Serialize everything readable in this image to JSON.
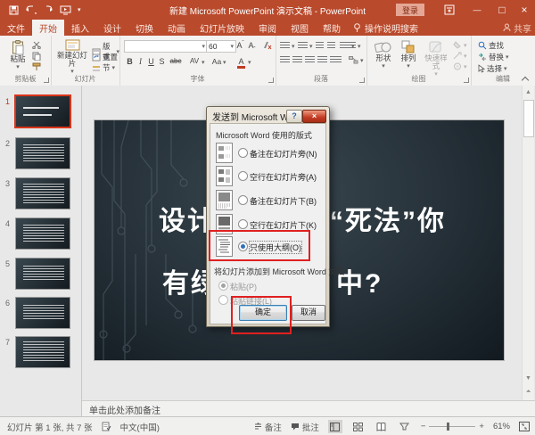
{
  "colors": {
    "accent_red": "#b94a2c",
    "selection_red": "#d8351a",
    "annotation_red": "#e02020",
    "signin_bg": "#e5a794",
    "slide_bg_center": "#3a4850",
    "slide_bg_edge": "#121a20"
  },
  "titlebar": {
    "title": "新建 Microsoft PowerPoint 演示文稿 - PowerPoint",
    "signin_label": "登录",
    "minimize_glyph": "—",
    "maximize_glyph": "□",
    "close_glyph": "×"
  },
  "tabs": [
    {
      "label": "文件"
    },
    {
      "label": "开始"
    },
    {
      "label": "插入"
    },
    {
      "label": "设计"
    },
    {
      "label": "切换"
    },
    {
      "label": "动画"
    },
    {
      "label": "幻灯片放映"
    },
    {
      "label": "审阅"
    },
    {
      "label": "视图"
    },
    {
      "label": "帮助"
    }
  ],
  "tellme_label": "操作说明搜索",
  "share_label": "共享",
  "ribbon": {
    "clipboard": {
      "group_label": "剪贴板",
      "paste_label": "粘贴"
    },
    "slides": {
      "group_label": "幻灯片",
      "new_slide_label": "新建幻灯片",
      "layout_label": "版式",
      "reset_label": "重置",
      "section_label": "节"
    },
    "font": {
      "group_label": "字体",
      "size_value": "60",
      "bold": "B",
      "italic": "I",
      "underline": "U",
      "strike": "S",
      "abc": "abc",
      "av": "AV",
      "aa": "Aa",
      "color": "A"
    },
    "paragraph": {
      "group_label": "段落"
    },
    "drawing": {
      "group_label": "绘图",
      "shapes_label": "形状",
      "arrange_label": "排列",
      "quick_styles_label": "快速样式"
    },
    "editing": {
      "group_label": "编辑",
      "find_label": "查找",
      "replace_label": "替换",
      "select_label": "选择"
    }
  },
  "slides_panel": {
    "selected_number": "1",
    "slides": [
      {
        "number": "1"
      },
      {
        "number": "2"
      },
      {
        "number": "3"
      },
      {
        "number": "4"
      },
      {
        "number": "5"
      },
      {
        "number": "6"
      },
      {
        "number": "7"
      }
    ]
  },
  "slide": {
    "line1_left": "设计",
    "line1_right": "“死法”你",
    "line2_left": "有绿",
    "line2_right": "中?"
  },
  "dialog": {
    "title": "发送到 Microsoft Word",
    "help_glyph": "?",
    "close_glyph": "×",
    "layout_group_label": "Microsoft Word 使用的版式",
    "options": [
      {
        "label": "备注在幻灯片旁(N)"
      },
      {
        "label": "空行在幻灯片旁(A)"
      },
      {
        "label": "备注在幻灯片下(B)"
      },
      {
        "label": "空行在幻灯片下(K)"
      },
      {
        "label": "只使用大纲(O)"
      }
    ],
    "selected_option": "只使用大纲(O)",
    "add_group_label": "将幻灯片添加到 Microsoft Word 文档",
    "paste_options": [
      {
        "label": "粘贴(P)"
      },
      {
        "label": "粘贴链接(L)"
      }
    ],
    "ok_label": "确定",
    "cancel_label": "取消"
  },
  "notes": {
    "placeholder": "单击此处添加备注"
  },
  "statusbar": {
    "slide_info": "幻灯片 第 1 张, 共 7 张",
    "language": "中文(中国)",
    "notes_label": "备注",
    "comments_label": "批注",
    "zoom_value": "61%"
  }
}
